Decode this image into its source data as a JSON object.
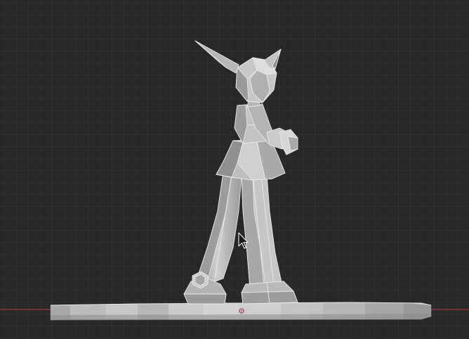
{
  "viewport": {
    "mode": "3d-viewport-orthographic-side",
    "background_color": "#282828",
    "grid_minor_color": "#343434",
    "grid_major_color": "#3a3a3a",
    "horizon_axis_color": "#9b3b46",
    "object_origin_color": "#a14a54"
  },
  "scene": {
    "objects": [
      {
        "name": "character-model",
        "kind": "low-poly mesh"
      },
      {
        "name": "base-pedestal",
        "kind": "low-poly mesh"
      }
    ],
    "mesh_colors": {
      "light": "#c9c9c9",
      "mid": "#a3a3a3",
      "dark": "#7b7b7b",
      "edge": "#e8e8e8"
    }
  },
  "icons": {
    "cursor": "mouse-pointer-icon"
  }
}
